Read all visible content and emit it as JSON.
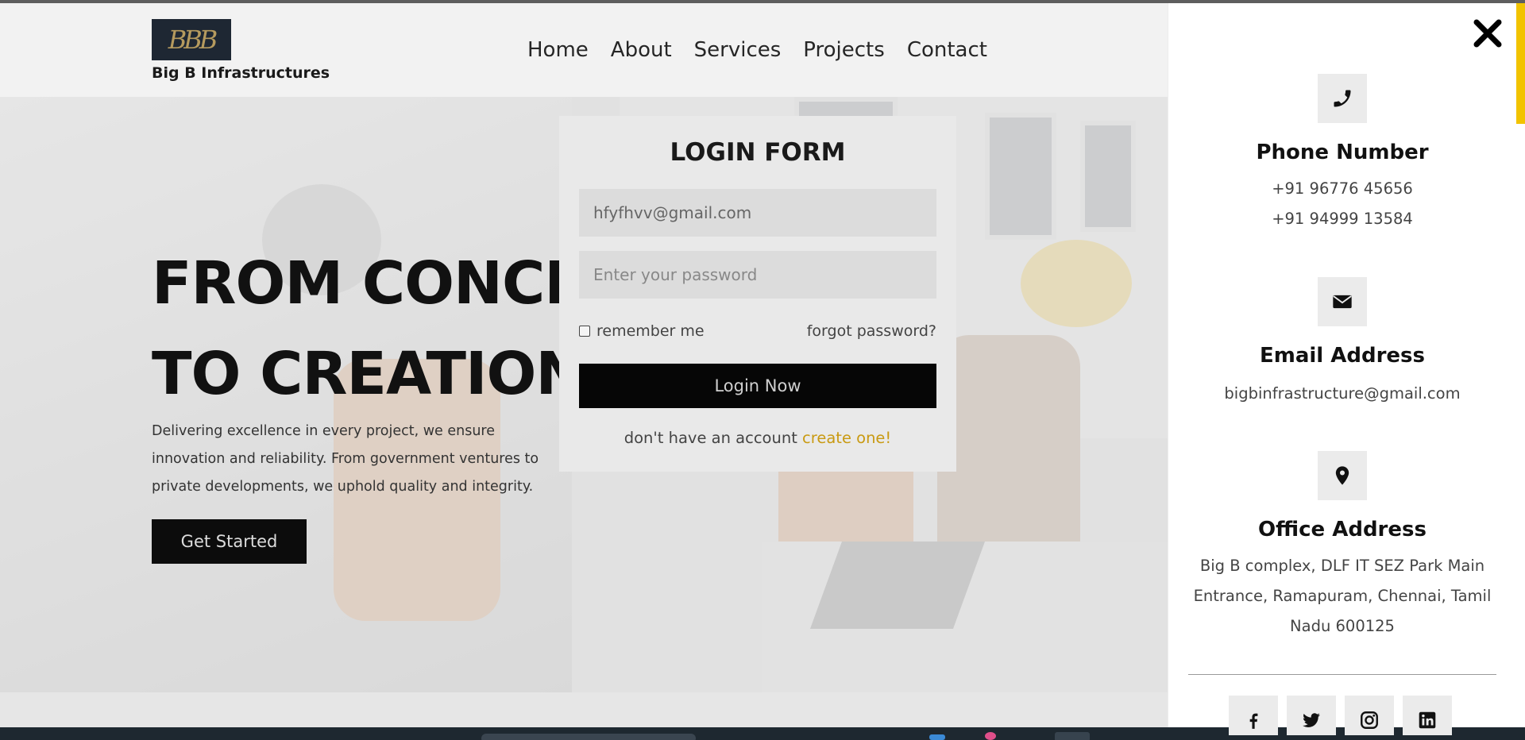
{
  "brand": {
    "logo_text": "BBB",
    "name": "Big B Infrastructures"
  },
  "nav": {
    "items": [
      "Home",
      "About",
      "Services",
      "Projects",
      "Contact"
    ]
  },
  "hero": {
    "title_line1": "FROM CONCEPT",
    "title_line2": "TO CREATION",
    "description": "Delivering excellence in every project, we ensure innovation and reliability. From government ventures to private developments, we uphold quality and integrity.",
    "cta_label": "Get Started"
  },
  "login": {
    "title": "LOGIN FORM",
    "email_value": "hfyfhvv@gmail.com",
    "password_placeholder": "Enter your password",
    "remember_label": "remember me",
    "forgot_label": "forgot password?",
    "submit_label": "Login Now",
    "signup_prompt": "don't have an account",
    "signup_link": "create one!"
  },
  "contact_panel": {
    "phone": {
      "icon": "phone-icon",
      "title": "Phone Number",
      "lines": [
        "+91 96776 45656",
        "+91 94999 13584"
      ]
    },
    "email": {
      "icon": "envelope-icon",
      "title": "Email Address",
      "lines": [
        "bigbinfrastructure@gmail.com"
      ]
    },
    "office": {
      "icon": "map-marker-icon",
      "title": "Office Address",
      "address": "Big B complex, DLF IT SEZ Park Main Entrance, Ramapuram, Chennai, Tamil Nadu 600125"
    },
    "socials": [
      "facebook-icon",
      "twitter-icon",
      "instagram-icon",
      "linkedin-icon"
    ]
  },
  "colors": {
    "accent": "#c99a12",
    "scroll_accent": "#f2c300",
    "button": "#060606",
    "panel_bg": "#ffffff"
  }
}
